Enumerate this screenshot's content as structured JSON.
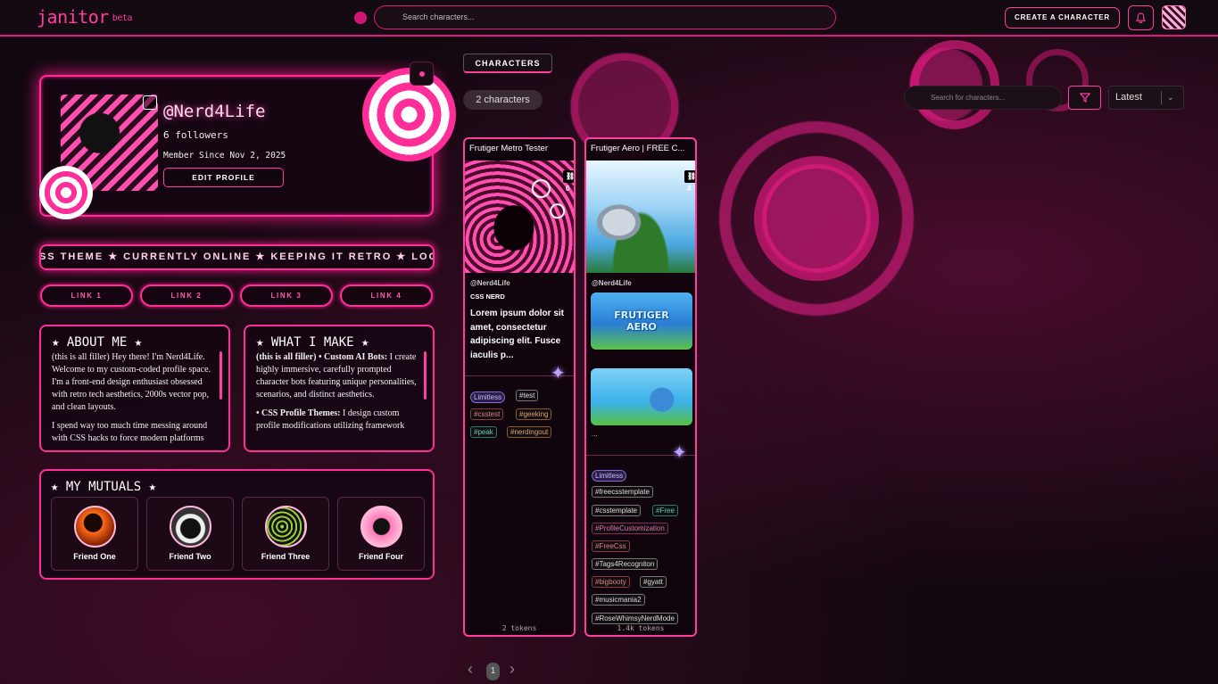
{
  "topbar": {
    "logo": "janitor",
    "beta": "beta",
    "search_placeholder": "Search characters...",
    "create_label": "CREATE A CHARACTER"
  },
  "profile": {
    "username": "@Nerd4Life",
    "followers": "6 followers",
    "member_since": "Member Since Nov 2, 2025",
    "edit_label": "EDIT PROFILE"
  },
  "marquee": "CSS THEME ★ CURRENTLY ONLINE ★ KEEPING IT RETRO ★ LOOP",
  "links": [
    "LINK 1",
    "LINK 2",
    "LINK 3",
    "LINK 4"
  ],
  "about": {
    "title": "★ ABOUT ME ★",
    "p1": "(this is all filler) Hey there! I'm Nerd4Life. Welcome to my custom-coded profile space. I'm a front-end design enthusiast obsessed with retro tech aesthetics, 2000s vector pop, and clean layouts.",
    "p2": "I spend way too much time messing around with CSS hacks to force modern platforms"
  },
  "make": {
    "title": "★ WHAT I MAKE ★",
    "p1_bold": "(this is all filler) • Custom AI Bots:",
    "p1": " I create highly immersive, carefully prompted character bots featuring unique personalities, scenarios, and distinct aesthetics.",
    "p2_bold": "• CSS Profile Themes:",
    "p2": " I design custom profile modifications utilizing framework"
  },
  "mutuals": {
    "title": "★ MY MUTUALS ★",
    "friends": [
      "Friend One",
      "Friend Two",
      "Friend Three",
      "Friend Four"
    ]
  },
  "characters": {
    "tab": "CHARACTERS",
    "count": "2 characters",
    "search_placeholder": "Search for characters...",
    "sort": "Latest",
    "cards": [
      {
        "title": "Frutiger Metro Tester",
        "badge": "0",
        "creator": "@Nerd4Life",
        "tagline": "CSS NERD",
        "desc": "Lorem ipsum dolor sit amet, consectetur adipiscing elit. Fusce iaculis p...",
        "tags": [
          "Limitless",
          "#test",
          "#csstest",
          "#geeking",
          "#peak",
          "#nerdingout"
        ],
        "tokens": "2 tokens"
      },
      {
        "title": "Frutiger Aero | FREE C...",
        "badge": "4",
        "creator": "@Nerd4Life",
        "img_text": "FRUTIGER AERO",
        "ellipsis": "...",
        "tags": [
          "Limitless",
          "#freecsstemplate",
          "#csstemplate",
          "#Free",
          "#ProfileCustomization",
          "#FreeCss",
          "#Tags4Recogniton",
          "#bigbooty",
          "#gyatt",
          "#musicmania2",
          "#RoseWhimsyNerdMode"
        ],
        "tokens": "1.4k tokens"
      }
    ]
  },
  "pager": {
    "prev": "‹",
    "page": "1",
    "next": "›"
  },
  "colors": {
    "accent": "#ff2e99",
    "bg": "#120810",
    "limitless": "#8a6ad8"
  },
  "icons": [
    "search-icon",
    "bell-icon",
    "filter-icon",
    "chevron-down-icon",
    "chat-icon",
    "menu-dot-icon"
  ]
}
